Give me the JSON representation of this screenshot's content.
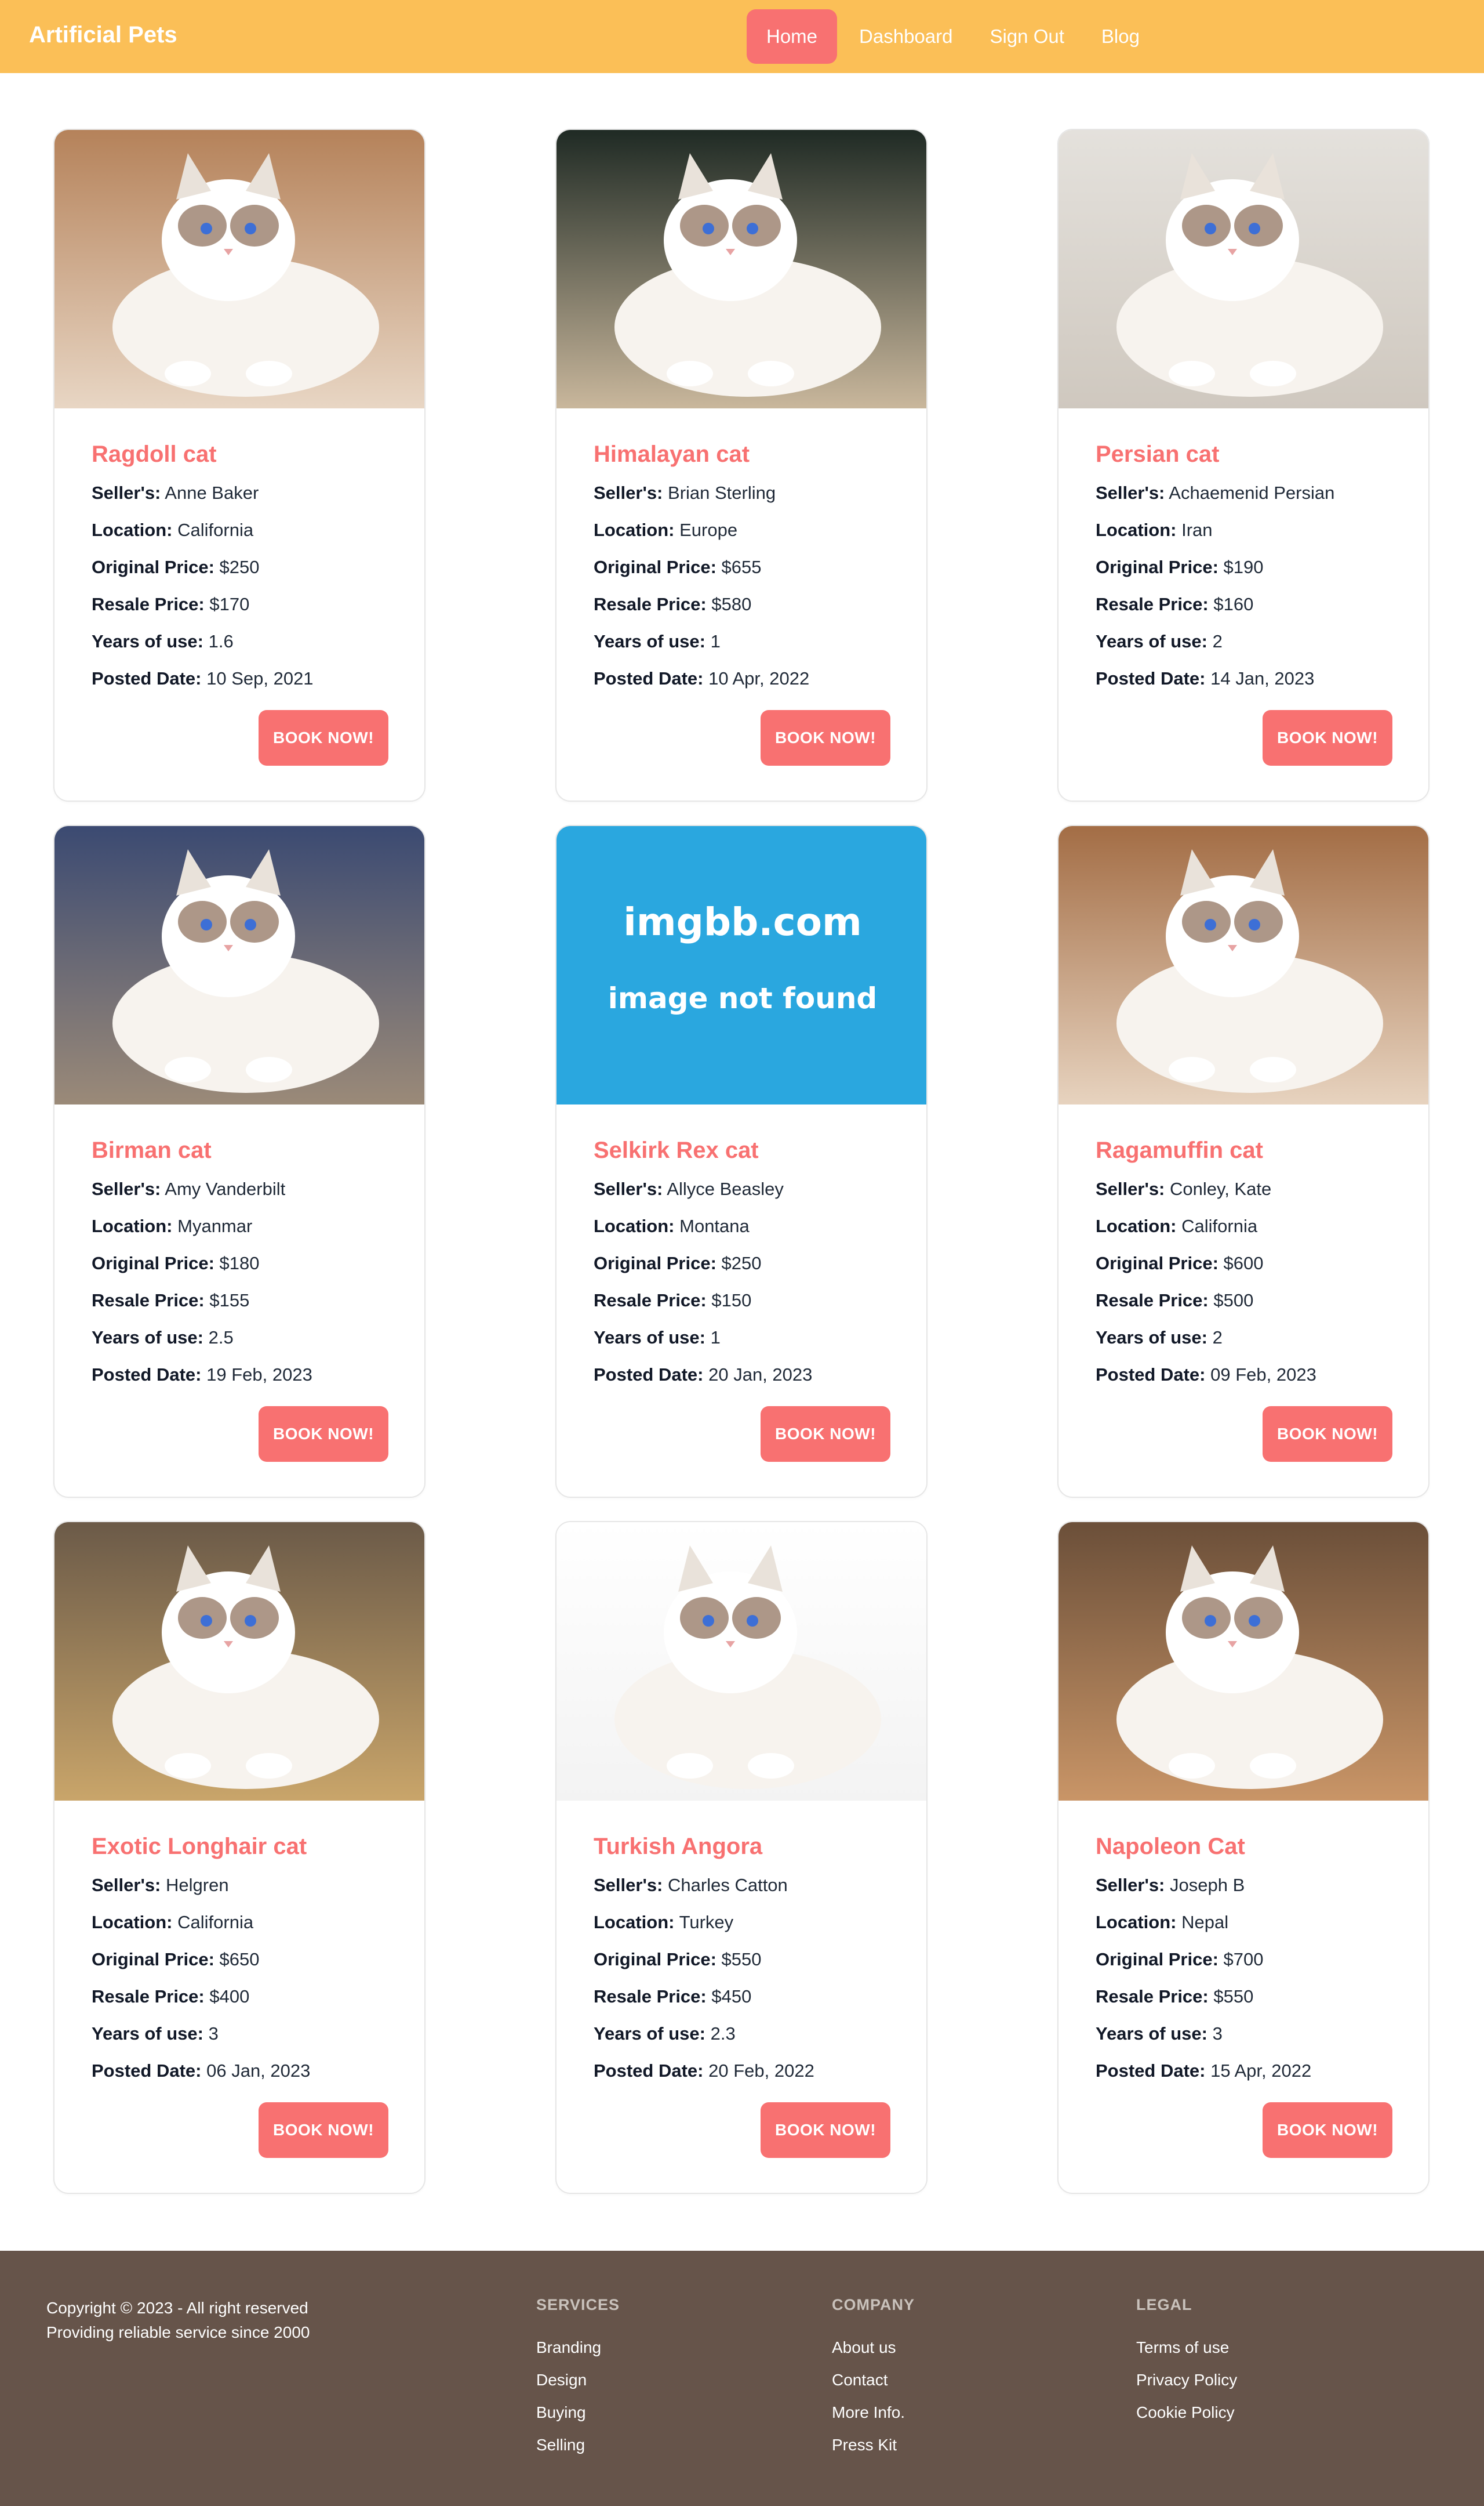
{
  "navbar": {
    "brand": "Artificial Pets",
    "links": [
      "Home",
      "Dashboard",
      "Sign Out",
      "Blog"
    ],
    "active": "Home",
    "bg_color": "#fbbf57",
    "accent_color": "#f87171"
  },
  "labels": {
    "seller": "Seller's:",
    "location": "Location:",
    "original_price": "Original Price:",
    "resale_price": "Resale Price:",
    "years": "Years of use:",
    "posted": "Posted Date:",
    "book": "BOOK NOW!"
  },
  "products": [
    {
      "name": "Ragdoll cat",
      "seller": "Anne Baker",
      "location": "California",
      "original_price": "$250",
      "resale_price": "$170",
      "years": "1.6",
      "posted": "10 Sep, 2021",
      "image": "cat-photo"
    },
    {
      "name": "Himalayan cat",
      "seller": "Brian Sterling",
      "location": "Europe",
      "original_price": "$655",
      "resale_price": "$580",
      "years": "1",
      "posted": "10 Apr, 2022",
      "image": "cat-photo"
    },
    {
      "name": "Persian cat",
      "seller": "Achaemenid Persian",
      "location": "Iran",
      "original_price": "$190",
      "resale_price": "$160",
      "years": "2",
      "posted": "14 Jan, 2023",
      "image": "cat-photo"
    },
    {
      "name": "Birman cat",
      "seller": "Amy Vanderbilt",
      "location": "Myanmar",
      "original_price": "$180",
      "resale_price": "$155",
      "years": "2.5",
      "posted": "19 Feb, 2023",
      "image": "cat-photo"
    },
    {
      "name": "Selkirk Rex cat",
      "seller": "Allyce Beasley",
      "location": "Montana",
      "original_price": "$250",
      "resale_price": "$150",
      "years": "1",
      "posted": "20 Jan, 2023",
      "image": "placeholder",
      "image_text": [
        "imgbb.com",
        "image not found"
      ]
    },
    {
      "name": "Ragamuffin cat",
      "seller": "Conley, Kate",
      "location": "California",
      "original_price": "$600",
      "resale_price": "$500",
      "years": "2",
      "posted": "09 Feb, 2023",
      "image": "cat-photo"
    },
    {
      "name": "Exotic Longhair cat",
      "seller": "Helgren",
      "location": "California",
      "original_price": "$650",
      "resale_price": "$400",
      "years": "3",
      "posted": "06 Jan, 2023",
      "image": "cat-photo"
    },
    {
      "name": "Turkish Angora",
      "seller": "Charles Catton",
      "location": "Turkey",
      "original_price": "$550",
      "resale_price": "$450",
      "years": "2.3",
      "posted": "20 Feb, 2022",
      "image": "cat-photo"
    },
    {
      "name": "Napoleon Cat",
      "seller": "Joseph B",
      "location": "Nepal",
      "original_price": "$700",
      "resale_price": "$550",
      "years": "3",
      "posted": "15 Apr, 2022",
      "image": "cat-photo"
    }
  ],
  "footer": {
    "copyright": "Copyright © 2023 - All right reserved",
    "tagline": "Providing reliable service since 2000",
    "services": {
      "title": "SERVICES",
      "links": [
        "Branding",
        "Design",
        "Buying",
        "Selling"
      ]
    },
    "company": {
      "title": "COMPANY",
      "links": [
        "About us",
        "Contact",
        "More Info.",
        "Press Kit"
      ]
    },
    "legal": {
      "title": "LEGAL",
      "links": [
        "Terms of use",
        "Privacy Policy",
        "Cookie Policy"
      ]
    },
    "bg_color": "#66544a"
  }
}
